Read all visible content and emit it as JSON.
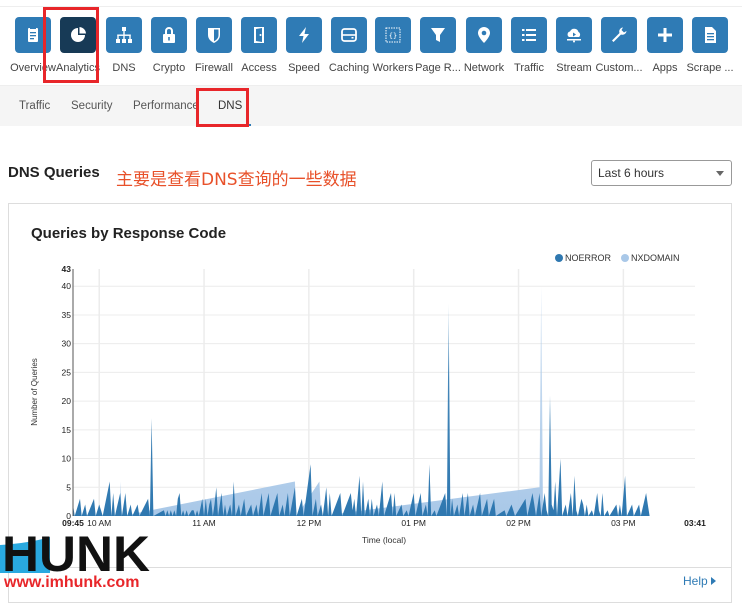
{
  "apps": [
    {
      "label": "Overview",
      "icon": "clipboard-icon"
    },
    {
      "label": "Analytics",
      "icon": "pie-chart-icon",
      "active": true
    },
    {
      "label": "DNS",
      "icon": "network-tree-icon"
    },
    {
      "label": "Crypto",
      "icon": "lock-icon"
    },
    {
      "label": "Firewall",
      "icon": "shield-icon"
    },
    {
      "label": "Access",
      "icon": "door-icon"
    },
    {
      "label": "Speed",
      "icon": "lightning-icon"
    },
    {
      "label": "Caching",
      "icon": "server-icon"
    },
    {
      "label": "Workers",
      "icon": "code-braces-icon"
    },
    {
      "label": "Page R...",
      "icon": "filter-icon"
    },
    {
      "label": "Network",
      "icon": "location-pin-icon"
    },
    {
      "label": "Traffic",
      "icon": "list-icon"
    },
    {
      "label": "Stream",
      "icon": "cloud-play-icon"
    },
    {
      "label": "Custom...",
      "icon": "wrench-icon"
    },
    {
      "label": "Apps",
      "icon": "plus-icon"
    },
    {
      "label": "Scrape ...",
      "icon": "document-icon"
    }
  ],
  "subnav": {
    "tabs": [
      {
        "label": "Traffic"
      },
      {
        "label": "Security"
      },
      {
        "label": "Performance"
      },
      {
        "label": "DNS",
        "active": true
      }
    ]
  },
  "section": {
    "title": "DNS Queries",
    "annotation": "主要是查看DNS查询的一些数据",
    "time_range": "Last 6 hours"
  },
  "card": {
    "help_label": "Help"
  },
  "watermark": {
    "logo_text": "HUNK",
    "url": "www.imhunk.com"
  },
  "colors": {
    "accent": "#2f7bb5",
    "active_tile": "#173a56",
    "noerror": "#2f78b0",
    "nxdomain": "#a9c8e8",
    "highlight": "#e8262a",
    "annotation": "#e8512a"
  },
  "chart_data": {
    "type": "area",
    "title": "Queries by Response Code",
    "xlabel": "Time (local)",
    "ylabel": "Number of Queries",
    "ylim": [
      0,
      43
    ],
    "yticks": [
      0,
      5,
      10,
      15,
      20,
      25,
      30,
      35,
      40,
      43
    ],
    "xlim_minutes": [
      585,
      941
    ],
    "xticks": [
      {
        "label": "09:45",
        "minute": 585,
        "bold": true
      },
      {
        "label": "10 AM",
        "minute": 600
      },
      {
        "label": "11 AM",
        "minute": 660
      },
      {
        "label": "12 PM",
        "minute": 720
      },
      {
        "label": "01 PM",
        "minute": 780
      },
      {
        "label": "02 PM",
        "minute": 840
      },
      {
        "label": "03 PM",
        "minute": 900
      },
      {
        "label": "03:41",
        "minute": 941,
        "bold": true
      }
    ],
    "grid": true,
    "legend_position": "top-right",
    "series": [
      {
        "name": "NOERROR",
        "points": [
          [
            585,
            2
          ],
          [
            586,
            0
          ],
          [
            589,
            3
          ],
          [
            590,
            0
          ],
          [
            592,
            2
          ],
          [
            593,
            0
          ],
          [
            597,
            3
          ],
          [
            598,
            0
          ],
          [
            600,
            2
          ],
          [
            601,
            1
          ],
          [
            602,
            0
          ],
          [
            606,
            6
          ],
          [
            607,
            0
          ],
          [
            608,
            4
          ],
          [
            609,
            0
          ],
          [
            612,
            4
          ],
          [
            613,
            0
          ],
          [
            615,
            4
          ],
          [
            616,
            0
          ],
          [
            618,
            2
          ],
          [
            619,
            0
          ],
          [
            622,
            2
          ],
          [
            623,
            0
          ],
          [
            628,
            3
          ],
          [
            629,
            0
          ],
          [
            630,
            17
          ],
          [
            631,
            0
          ],
          [
            637,
            1
          ],
          [
            638,
            0
          ],
          [
            639,
            1
          ],
          [
            640,
            0
          ],
          [
            641,
            1
          ],
          [
            642,
            0
          ],
          [
            643,
            1
          ],
          [
            644,
            0
          ],
          [
            645,
            3
          ],
          [
            646,
            4
          ],
          [
            647,
            0
          ],
          [
            648,
            1
          ],
          [
            649,
            0
          ],
          [
            650,
            1
          ],
          [
            651,
            0
          ],
          [
            653,
            1
          ],
          [
            654,
            1
          ],
          [
            655,
            0
          ],
          [
            656,
            1
          ],
          [
            657,
            0
          ],
          [
            659,
            3
          ],
          [
            660,
            0
          ],
          [
            661,
            3
          ],
          [
            662,
            0
          ],
          [
            663,
            2
          ],
          [
            664,
            3
          ],
          [
            665,
            0
          ],
          [
            666,
            2
          ],
          [
            667,
            5
          ],
          [
            668,
            0
          ],
          [
            669,
            2
          ],
          [
            670,
            4
          ],
          [
            671,
            0
          ],
          [
            672,
            2
          ],
          [
            673,
            0
          ],
          [
            675,
            2
          ],
          [
            676,
            0
          ],
          [
            677,
            6
          ],
          [
            678,
            0
          ],
          [
            680,
            2
          ],
          [
            681,
            0
          ],
          [
            683,
            3
          ],
          [
            684,
            0
          ],
          [
            687,
            2
          ],
          [
            688,
            0
          ],
          [
            690,
            2
          ],
          [
            691,
            0
          ],
          [
            693,
            4
          ],
          [
            694,
            0
          ],
          [
            697,
            4
          ],
          [
            698,
            0
          ],
          [
            702,
            4
          ],
          [
            703,
            0
          ],
          [
            705,
            2
          ],
          [
            706,
            0
          ],
          [
            708,
            4
          ],
          [
            709,
            0
          ],
          [
            712,
            5
          ],
          [
            713,
            0
          ],
          [
            716,
            3
          ],
          [
            717,
            0
          ],
          [
            721,
            9
          ],
          [
            722,
            0
          ],
          [
            724,
            3
          ],
          [
            725,
            0
          ],
          [
            727,
            2
          ],
          [
            728,
            0
          ],
          [
            730,
            5
          ],
          [
            731,
            0
          ],
          [
            732,
            4
          ],
          [
            733,
            0
          ],
          [
            738,
            4
          ],
          [
            739,
            0
          ],
          [
            744,
            4
          ],
          [
            745,
            1
          ],
          [
            746,
            3
          ],
          [
            747,
            0
          ],
          [
            749,
            7
          ],
          [
            750,
            0
          ],
          [
            751,
            6
          ],
          [
            752,
            0
          ],
          [
            754,
            3
          ],
          [
            755,
            0
          ],
          [
            756,
            3
          ],
          [
            757,
            0
          ],
          [
            759,
            2
          ],
          [
            760,
            0
          ],
          [
            762,
            6
          ],
          [
            763,
            0
          ],
          [
            767,
            4
          ],
          [
            768,
            0
          ],
          [
            769,
            4
          ],
          [
            770,
            0
          ],
          [
            773,
            2
          ],
          [
            774,
            0
          ],
          [
            776,
            1
          ],
          [
            777,
            0
          ],
          [
            780,
            4
          ],
          [
            781,
            0
          ],
          [
            784,
            4
          ],
          [
            785,
            0
          ],
          [
            787,
            2
          ],
          [
            788,
            0
          ],
          [
            789,
            9
          ],
          [
            790,
            0
          ],
          [
            792,
            1
          ],
          [
            793,
            0
          ],
          [
            798,
            4
          ],
          [
            799,
            0
          ],
          [
            800,
            37
          ],
          [
            801,
            0
          ],
          [
            802,
            3
          ],
          [
            803,
            0
          ],
          [
            805,
            2
          ],
          [
            806,
            0
          ],
          [
            808,
            4
          ],
          [
            809,
            0
          ],
          [
            811,
            4
          ],
          [
            812,
            0
          ],
          [
            814,
            2
          ],
          [
            815,
            0
          ],
          [
            818,
            4
          ],
          [
            819,
            0
          ],
          [
            822,
            3
          ],
          [
            823,
            0
          ],
          [
            826,
            3
          ],
          [
            827,
            0
          ],
          [
            832,
            1
          ],
          [
            833,
            0
          ],
          [
            836,
            2
          ],
          [
            837,
            1
          ],
          [
            838,
            0
          ],
          [
            844,
            3
          ],
          [
            845,
            0
          ],
          [
            848,
            4
          ],
          [
            849,
            2
          ],
          [
            850,
            0
          ],
          [
            852,
            4
          ],
          [
            853,
            0
          ],
          [
            855,
            4
          ],
          [
            856,
            1
          ],
          [
            857,
            0
          ],
          [
            858,
            21
          ],
          [
            859,
            2
          ],
          [
            860,
            1
          ],
          [
            861,
            6
          ],
          [
            862,
            0
          ],
          [
            864,
            10
          ],
          [
            865,
            0
          ],
          [
            867,
            2
          ],
          [
            868,
            0
          ],
          [
            870,
            4
          ],
          [
            871,
            0
          ],
          [
            872,
            7
          ],
          [
            873,
            1
          ],
          [
            874,
            0
          ],
          [
            876,
            3
          ],
          [
            877,
            2
          ],
          [
            878,
            0
          ],
          [
            879,
            2
          ],
          [
            880,
            0
          ],
          [
            882,
            1
          ],
          [
            883,
            0
          ],
          [
            885,
            4
          ],
          [
            886,
            1
          ],
          [
            887,
            0
          ],
          [
            888,
            4
          ],
          [
            889,
            0
          ],
          [
            891,
            1
          ],
          [
            892,
            0
          ],
          [
            896,
            2
          ],
          [
            897,
            0
          ],
          [
            898,
            2
          ],
          [
            899,
            0
          ],
          [
            901,
            7
          ],
          [
            902,
            0
          ],
          [
            905,
            2
          ],
          [
            906,
            0
          ],
          [
            909,
            2
          ],
          [
            910,
            0
          ],
          [
            913,
            4
          ],
          [
            914,
            2
          ],
          [
            915,
            0
          ]
        ]
      },
      {
        "name": "NXDOMAIN",
        "points": [
          [
            612,
            6
          ],
          [
            613,
            0
          ],
          [
            712,
            6
          ],
          [
            713,
            0
          ],
          [
            726,
            6
          ],
          [
            727,
            0
          ],
          [
            852,
            5
          ],
          [
            853,
            40
          ],
          [
            854,
            0
          ]
        ]
      }
    ]
  }
}
